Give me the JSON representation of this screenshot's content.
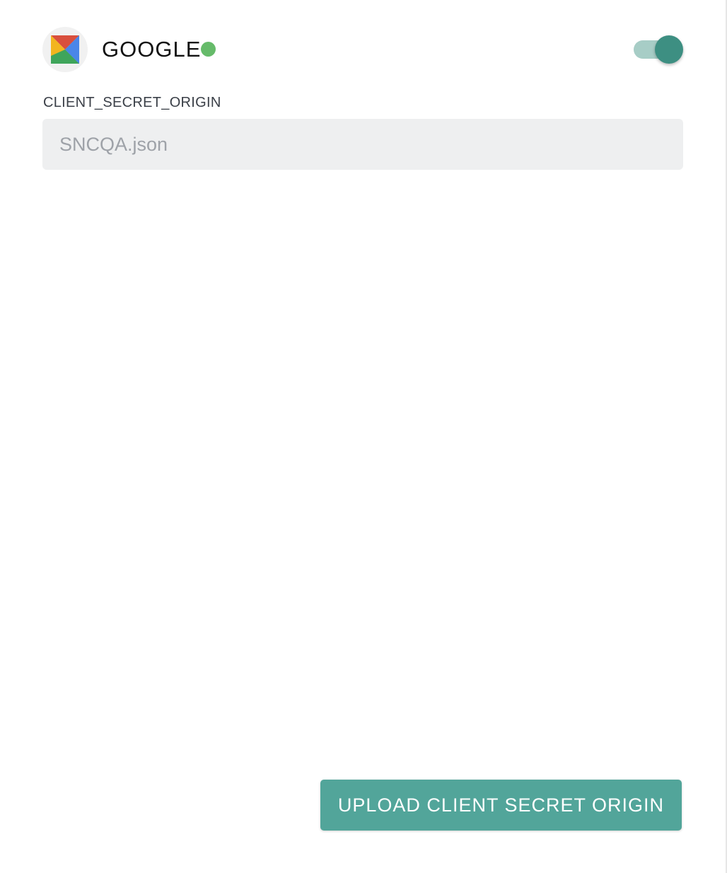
{
  "provider": {
    "name": "GOOGLE",
    "logo": "google-mail-logo",
    "status": "active",
    "status_color": "#66bb6a",
    "enabled": true,
    "toggle_color": "#3d8f82"
  },
  "client_secret": {
    "label": "CLIENT_SECRET_ORIGIN",
    "placeholder": "SNCQA.json",
    "value": ""
  },
  "actions": {
    "upload_label": "UPLOAD CLIENT SECRET ORIGIN",
    "upload_color": "#52a59a"
  }
}
